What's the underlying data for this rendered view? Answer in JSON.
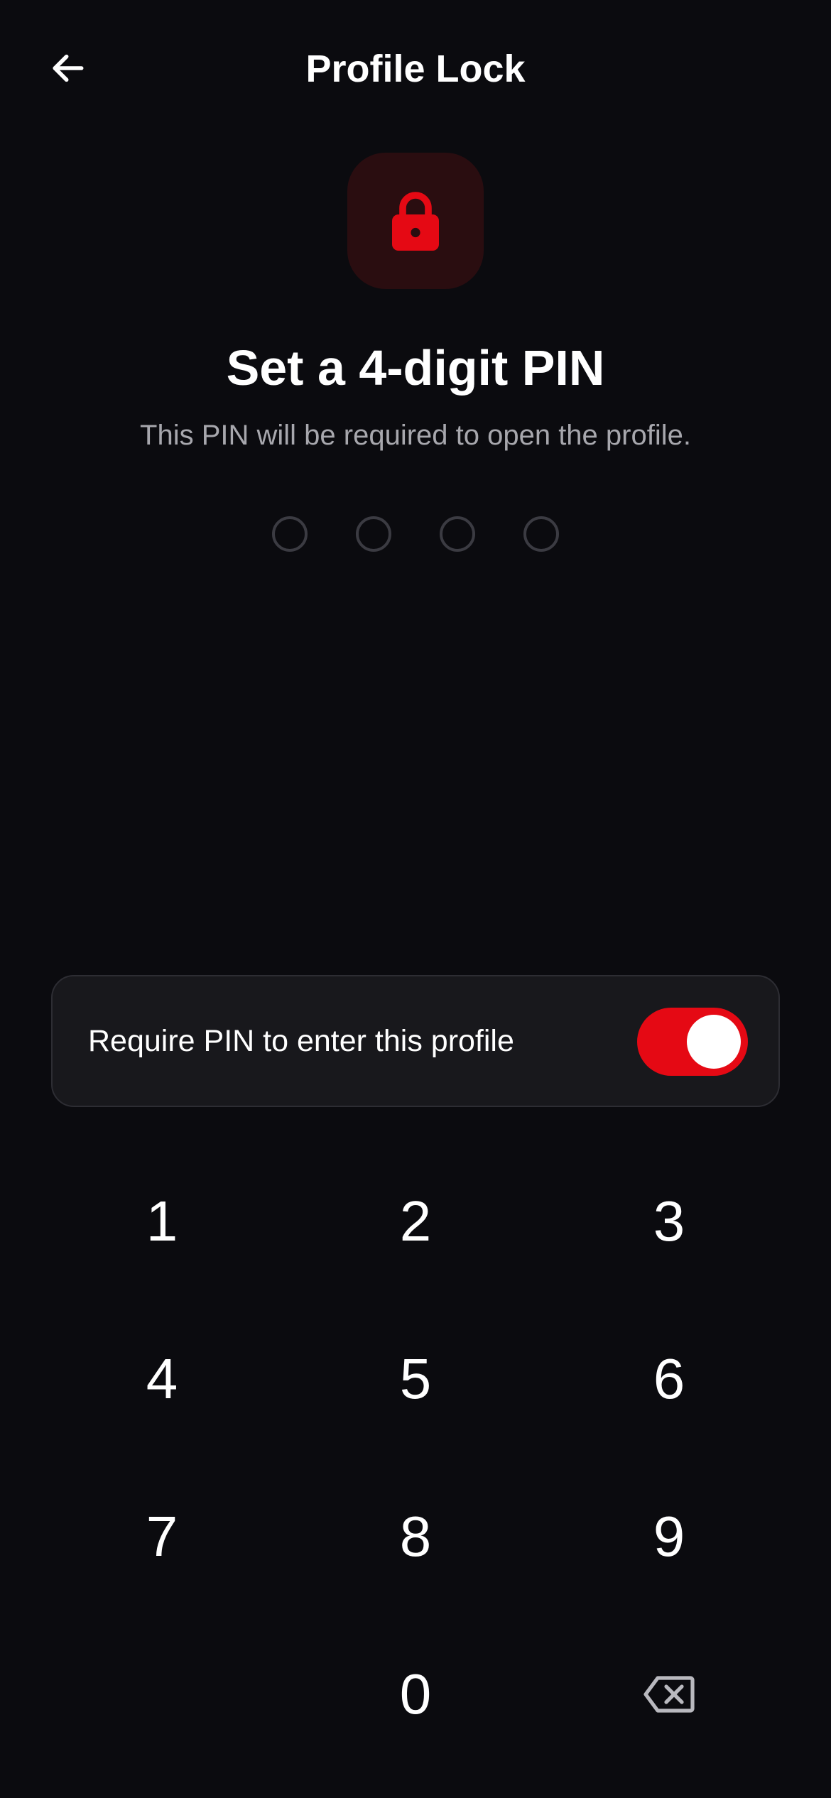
{
  "header": {
    "title": "Profile Lock",
    "back_icon": "arrow-left-icon"
  },
  "lock": {
    "icon": "lock-icon",
    "accent_color": "#e50914",
    "tile_color": "#2a0d10"
  },
  "prompt": {
    "heading": "Set a 4-digit PIN",
    "subtitle": "This PIN will be required to open the profile."
  },
  "pin": {
    "length": 4,
    "entered": 0
  },
  "require_pin": {
    "label": "Require PIN to enter this profile",
    "enabled": true
  },
  "keypad": {
    "keys": [
      "1",
      "2",
      "3",
      "4",
      "5",
      "6",
      "7",
      "8",
      "9",
      "0"
    ],
    "backspace_icon": "backspace-icon"
  }
}
